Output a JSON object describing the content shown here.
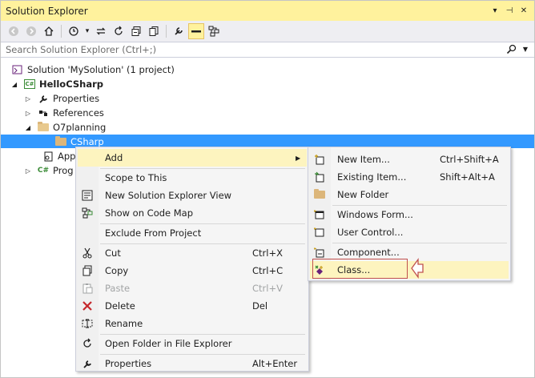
{
  "window": {
    "title": "Solution Explorer",
    "pin_glyph": "⊣",
    "dropdown_glyph": "▾",
    "close_glyph": "✕"
  },
  "toolbar": {
    "icons": [
      "back-icon",
      "forward-icon",
      "home-icon",
      "history-icon",
      "sync-icon",
      "refresh-icon",
      "collapse-icon",
      "show-all-files-icon",
      "properties-icon",
      "preview-icon",
      "class-diagram-icon"
    ]
  },
  "search": {
    "placeholder": "Search Solution Explorer (Ctrl+;)"
  },
  "tree": {
    "solution": "Solution 'MySolution' (1 project)",
    "project": "HelloCSharp",
    "properties": "Properties",
    "references": "References",
    "folder": "O7planning",
    "subfolder": "CSharp",
    "app": "App",
    "prog": "Prog"
  },
  "context_menu": {
    "items": [
      {
        "label": "Add",
        "shortcut": "",
        "submenu": true
      },
      {
        "label": "Scope to This",
        "shortcut": ""
      },
      {
        "label": "New Solution Explorer View",
        "shortcut": ""
      },
      {
        "label": "Show on Code Map",
        "shortcut": ""
      },
      {
        "label": "Exclude From Project",
        "shortcut": ""
      },
      {
        "label": "Cut",
        "shortcut": "Ctrl+X"
      },
      {
        "label": "Copy",
        "shortcut": "Ctrl+C"
      },
      {
        "label": "Paste",
        "shortcut": "Ctrl+V",
        "disabled": true
      },
      {
        "label": "Delete",
        "shortcut": "Del"
      },
      {
        "label": "Rename",
        "shortcut": ""
      },
      {
        "label": "Open Folder in File Explorer",
        "shortcut": ""
      },
      {
        "label": "Properties",
        "shortcut": "Alt+Enter"
      }
    ]
  },
  "add_submenu": {
    "items": [
      {
        "label": "New Item...",
        "shortcut": "Ctrl+Shift+A"
      },
      {
        "label": "Existing Item...",
        "shortcut": "Shift+Alt+A"
      },
      {
        "label": "New Folder",
        "shortcut": ""
      },
      {
        "label": "Windows Form...",
        "shortcut": ""
      },
      {
        "label": "User Control...",
        "shortcut": ""
      },
      {
        "label": "Component...",
        "shortcut": ""
      },
      {
        "label": "Class...",
        "shortcut": ""
      }
    ]
  },
  "colors": {
    "selection": "#3399ff",
    "title_bar": "#fff29d",
    "highlight": "#fdf4bf",
    "callout": "#c0504d"
  }
}
